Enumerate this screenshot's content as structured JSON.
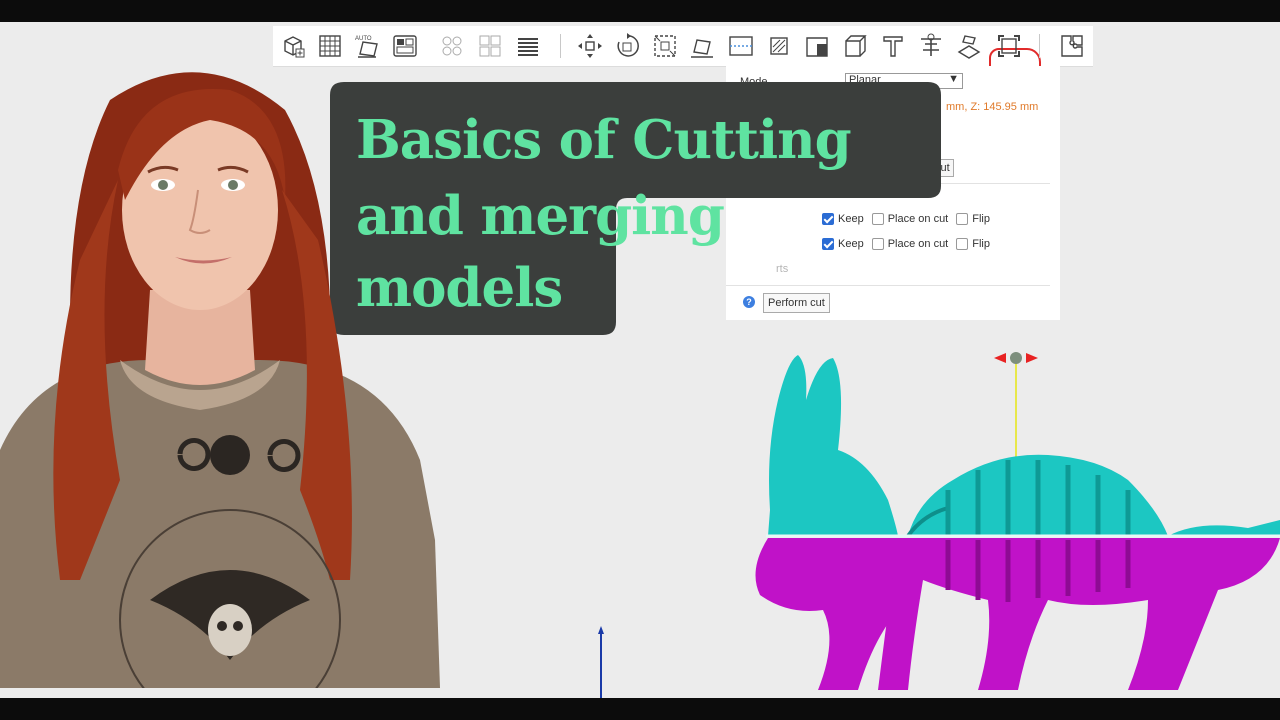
{
  "toolbar": {
    "icons": [
      "add-cube-icon",
      "grid-icon",
      "auto-orient-icon",
      "arrange-icon",
      "split-objects-icon",
      "split-parts-icon",
      "layers-icon",
      "move-icon",
      "rotate-icon",
      "scale-icon",
      "lay-on-face-icon",
      "cut-icon",
      "place-on-face-icon",
      "cut-plane-icon",
      "cube-outline-icon",
      "text-icon",
      "emboss-icon",
      "support-paint-icon",
      "fullscreen-icon",
      "assembly-icon"
    ],
    "active_tool": "cut-icon",
    "highlight_color": "#e12b2b"
  },
  "cut_panel": {
    "mode_label": "Mode",
    "mode_value": "Planar",
    "coords_text": "mm,  Z: 145.95 mm",
    "cut_button_fragment": "cut",
    "upper_part": {
      "keep_label": "Keep",
      "keep": true,
      "place_on_cut_label": "Place on cut",
      "place_on_cut": false,
      "flip_label": "Flip",
      "flip": false
    },
    "lower_part": {
      "keep_label": "Keep",
      "keep": true,
      "place_on_cut_label": "Place on cut",
      "place_on_cut": false,
      "flip_label": "Flip",
      "flip": false
    },
    "parts_label_fragment": "rts",
    "perform_cut_label": "Perform cut",
    "help_icon": "?"
  },
  "title": {
    "line1": "Basics of Cutting",
    "line2": "and merging",
    "line3": "models",
    "text_color": "#5fe3a1",
    "card_color": "#3b3e3c"
  },
  "model": {
    "upper_color": "#1cc7c2",
    "lower_color": "#c012c8"
  }
}
